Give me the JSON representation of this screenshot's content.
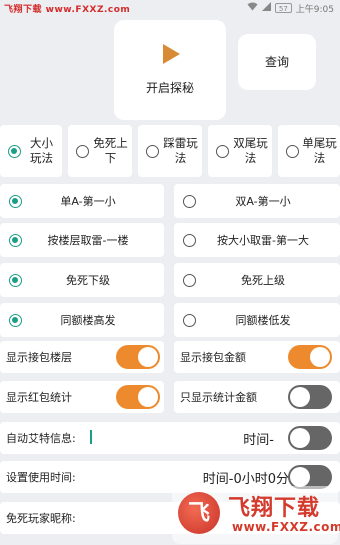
{
  "status_bar": {
    "watermark": "飞翔下载 www.FXXZ.com",
    "battery": "57",
    "time": "上午9:05"
  },
  "actions": {
    "start_label": "开启探秘",
    "query_label": "查询"
  },
  "modes": [
    {
      "line1": "大小",
      "line2": "玩法",
      "selected": true
    },
    {
      "line1": "免死上",
      "line2": "下",
      "selected": false
    },
    {
      "line1": "踩雷玩",
      "line2": "法",
      "selected": false
    },
    {
      "line1": "双尾玩",
      "line2": "法",
      "selected": false
    },
    {
      "line1": "单尾玩",
      "line2": "法",
      "selected": false
    }
  ],
  "options": [
    {
      "left": "单A-第一小",
      "left_selected": true,
      "right": "双A-第一小",
      "right_selected": false
    },
    {
      "left": "按楼层取雷-一楼",
      "left_selected": true,
      "right": "按大小取雷-第一大",
      "right_selected": false
    },
    {
      "left": "免死下级",
      "left_selected": true,
      "right": "免死上级",
      "right_selected": false
    },
    {
      "left": "同额楼高发",
      "left_selected": true,
      "right": "同额楼低发",
      "right_selected": false
    }
  ],
  "toggles": {
    "show_floor": {
      "label": "显示接包楼层",
      "on": true
    },
    "show_amount": {
      "label": "显示接包金额",
      "on": true
    },
    "show_stats": {
      "label": "显示红包统计",
      "on": true
    },
    "stats_amount_only": {
      "label": "只显示统计金额",
      "on": false
    }
  },
  "auto_at": {
    "label": "自动艾特信息:",
    "right_text": "时间-",
    "on": false
  },
  "usage_time": {
    "label": "设置使用时间:",
    "right_text": "时间-0小时0分钟",
    "on": false
  },
  "nickname": {
    "label": "免死玩家昵称:"
  },
  "watermark_bottom": {
    "logo": "飞",
    "title": "飞翔下载",
    "url": "www.FXXZ.com"
  }
}
